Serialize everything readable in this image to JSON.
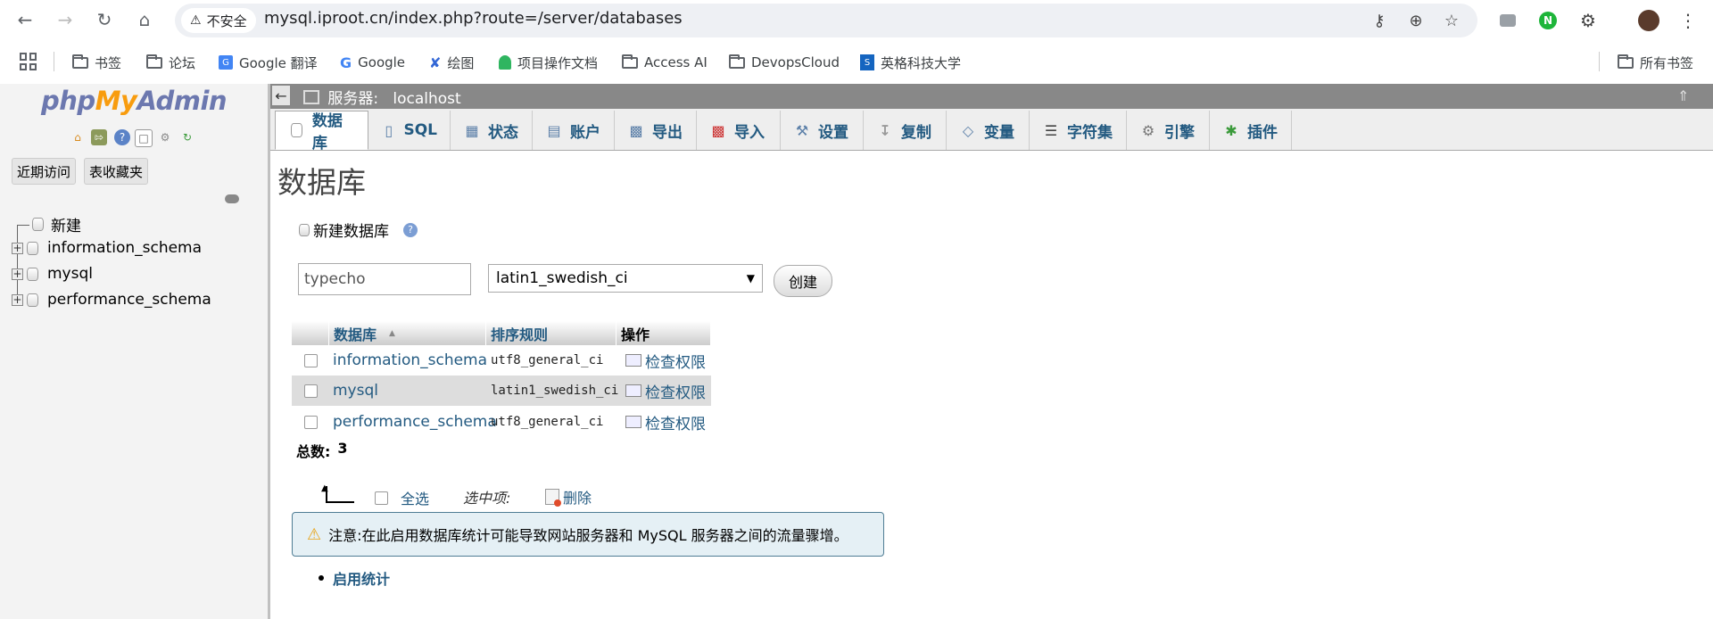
{
  "browser": {
    "insecure_label": "不安全",
    "url": "mysql.iproot.cn/index.php?route=/server/databases",
    "bookmarks": [
      {
        "label": "书签",
        "icon": "folder-icon"
      },
      {
        "label": "论坛",
        "icon": "folder-icon"
      },
      {
        "label": "Google 翻译",
        "icon": "google-translate-icon"
      },
      {
        "label": "Google",
        "icon": "google-icon"
      },
      {
        "label": "绘图",
        "icon": "drawing-icon"
      },
      {
        "label": "项目操作文档",
        "icon": "doc-icon"
      },
      {
        "label": "Access AI",
        "icon": "folder-icon"
      },
      {
        "label": "DevopsCloud",
        "icon": "folder-icon"
      },
      {
        "label": "英格科技大学",
        "icon": "school-icon"
      },
      {
        "label": "所有书签",
        "icon": "folder-icon"
      }
    ]
  },
  "left_nav": {
    "logo": {
      "php": "php",
      "my": "My",
      "admin": "Admin"
    },
    "tabs": [
      "近期访问",
      "表收藏夹"
    ],
    "tree": [
      "新建",
      "information_schema",
      "mysql",
      "performance_schema"
    ]
  },
  "server_bar": {
    "label": "服务器:",
    "server": "localhost"
  },
  "tabs": [
    {
      "label": "数据库",
      "icon": "database-icon"
    },
    {
      "label": "SQL",
      "icon": "sql-icon"
    },
    {
      "label": "状态",
      "icon": "status-icon"
    },
    {
      "label": "账户",
      "icon": "accounts-icon"
    },
    {
      "label": "导出",
      "icon": "export-icon"
    },
    {
      "label": "导入",
      "icon": "import-icon"
    },
    {
      "label": "设置",
      "icon": "settings-icon"
    },
    {
      "label": "复制",
      "icon": "replication-icon"
    },
    {
      "label": "变量",
      "icon": "variables-icon"
    },
    {
      "label": "字符集",
      "icon": "charset-icon"
    },
    {
      "label": "引擎",
      "icon": "engine-icon"
    },
    {
      "label": "插件",
      "icon": "plugin-icon"
    }
  ],
  "main": {
    "title": "数据库",
    "create_label": "新建数据库",
    "db_name_value": "typecho",
    "collation_value": "latin1_swedish_ci",
    "create_button": "创建",
    "table": {
      "headers": [
        "数据库",
        "排序规则",
        "操作"
      ],
      "rows": [
        {
          "name": "information_schema",
          "collation": "utf8_general_ci",
          "action": "检查权限"
        },
        {
          "name": "mysql",
          "collation": "latin1_swedish_ci",
          "action": "检查权限"
        },
        {
          "name": "performance_schema",
          "collation": "utf8_general_ci",
          "action": "检查权限"
        }
      ],
      "total_label": "总数:",
      "total_value": "3"
    },
    "select_all": "全选",
    "with_selected": "选中项:",
    "delete": "删除",
    "notice": "注意:在此启用数据库统计可能导致网站服务器和 MySQL 服务器之间的流量骤增。",
    "enable_stats": "启用统计"
  }
}
